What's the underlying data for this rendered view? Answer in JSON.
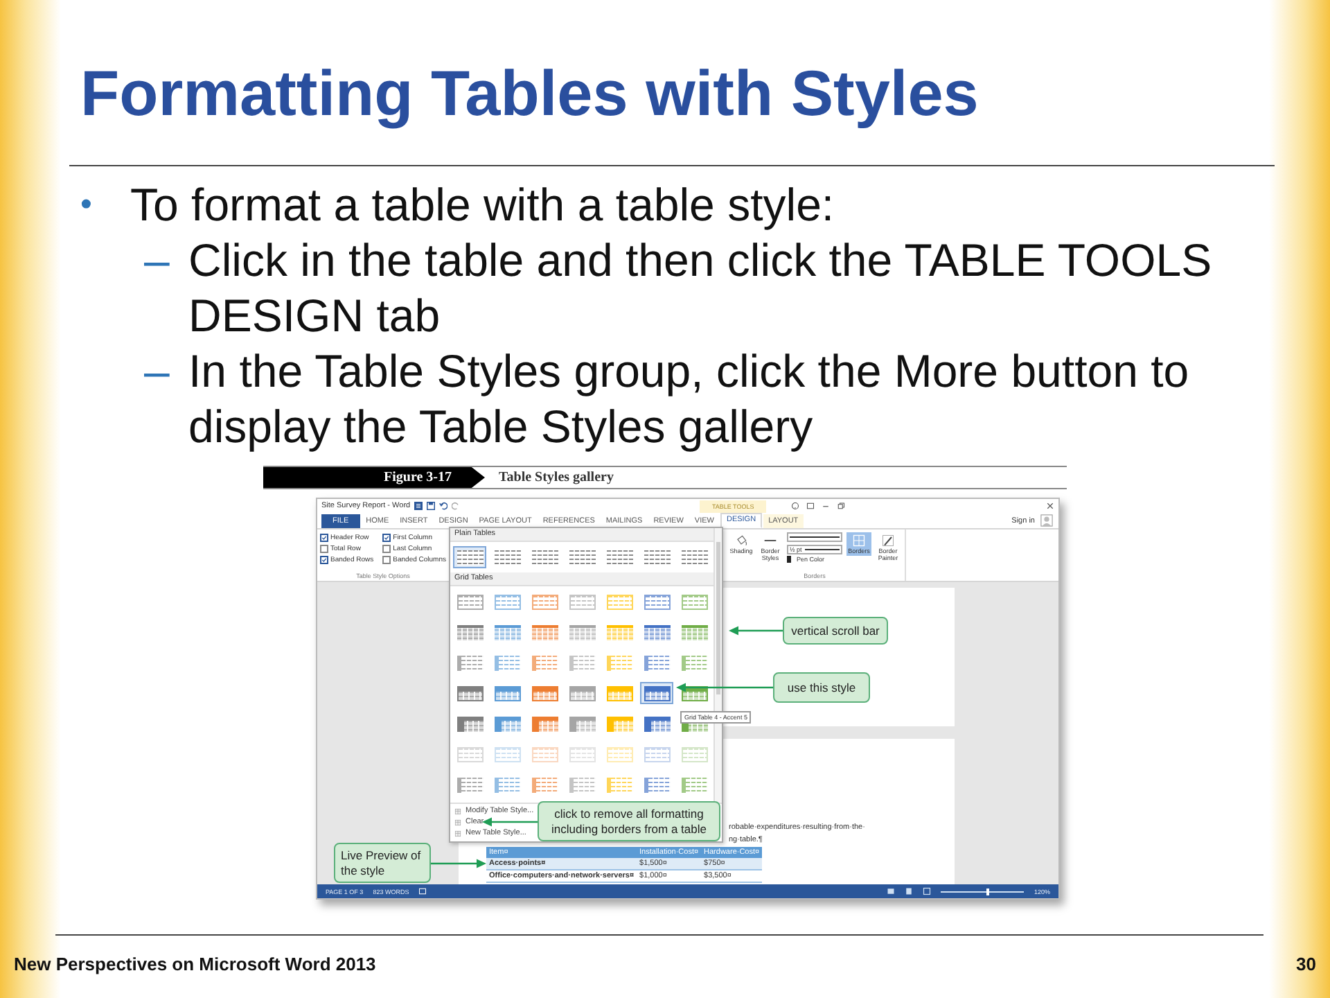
{
  "slide": {
    "title": "Formatting Tables with Styles",
    "bullets": [
      {
        "marker": "•",
        "text": "To format a table with a table style:",
        "children": [
          {
            "marker": "–",
            "text": "Click in the table and then click the TABLE TOOLS DESIGN tab"
          },
          {
            "marker": "–",
            "text": "In the Table Styles group, click the More button to display the Table Styles gallery"
          }
        ]
      }
    ]
  },
  "figure": {
    "number": "Figure 3-17",
    "caption": "Table Styles gallery",
    "window": {
      "title": "Site Survey Report - Word",
      "contextual_label": "TABLE TOOLS",
      "sign_in": "Sign in",
      "tabs": [
        {
          "label": "FILE",
          "kind": "file",
          "selected": false
        },
        {
          "label": "HOME",
          "kind": "normal",
          "selected": false
        },
        {
          "label": "INSERT",
          "kind": "normal",
          "selected": false
        },
        {
          "label": "DESIGN",
          "kind": "normal",
          "selected": false
        },
        {
          "label": "PAGE LAYOUT",
          "kind": "normal",
          "selected": false
        },
        {
          "label": "REFERENCES",
          "kind": "normal",
          "selected": false
        },
        {
          "label": "MAILINGS",
          "kind": "normal",
          "selected": false
        },
        {
          "label": "REVIEW",
          "kind": "normal",
          "selected": false
        },
        {
          "label": "VIEW",
          "kind": "normal",
          "selected": false
        },
        {
          "label": "DESIGN",
          "kind": "contextual",
          "selected": true
        },
        {
          "label": "LAYOUT",
          "kind": "contextual",
          "selected": false
        }
      ],
      "style_options": {
        "group_label": "Table Style Options",
        "items": [
          {
            "label": "Header Row",
            "checked": true
          },
          {
            "label": "First Column",
            "checked": true
          },
          {
            "label": "Total Row",
            "checked": false
          },
          {
            "label": "Last Column",
            "checked": false
          },
          {
            "label": "Banded Rows",
            "checked": true
          },
          {
            "label": "Banded Columns",
            "checked": false
          }
        ]
      },
      "borders_group": {
        "shading": "Shading",
        "border_styles": "Border Styles",
        "weight": "½ pt",
        "pen_color": "Pen Color",
        "borders": "Borders",
        "border_painter": "Border Painter",
        "group_label": "Borders"
      },
      "gallery": {
        "plain_label": "Plain Tables",
        "grid_label": "Grid Tables",
        "tooltip": "Grid Table 4 - Accent 5",
        "columns": [
          {
            "color": "#7f7f7f"
          },
          {
            "color": "#5b9bd5"
          },
          {
            "color": "#ed7d31"
          },
          {
            "color": "#a5a5a5"
          },
          {
            "color": "#ffc000"
          },
          {
            "color": "#4472c4"
          },
          {
            "color": "#70ad47"
          }
        ],
        "rows": [
          {
            "kind": "plain",
            "cells": [
              {
                "highlighted": true
              },
              {
                "highlighted": false
              },
              {
                "highlighted": false
              },
              {
                "highlighted": false
              },
              {
                "highlighted": false
              },
              {
                "highlighted": false
              },
              {
                "highlighted": false
              }
            ]
          },
          {
            "kind": "outline",
            "cells": [
              {
                "highlighted": false
              },
              {
                "highlighted": false
              },
              {
                "highlighted": false
              },
              {
                "highlighted": false
              },
              {
                "highlighted": false
              },
              {
                "highlighted": false
              },
              {
                "highlighted": false
              }
            ]
          },
          {
            "kind": "tinted",
            "cells": [
              {
                "highlighted": false
              },
              {
                "highlighted": false
              },
              {
                "highlighted": false
              },
              {
                "highlighted": false
              },
              {
                "highlighted": false
              },
              {
                "highlighted": false
              },
              {
                "highlighted": false
              }
            ]
          },
          {
            "kind": "list",
            "cells": [
              {
                "highlighted": false
              },
              {
                "highlighted": false
              },
              {
                "highlighted": false
              },
              {
                "highlighted": false
              },
              {
                "highlighted": false
              },
              {
                "highlighted": false
              },
              {
                "highlighted": false
              }
            ]
          },
          {
            "kind": "header",
            "cells": [
              {
                "highlighted": false
              },
              {
                "highlighted": false
              },
              {
                "highlighted": false
              },
              {
                "highlighted": false
              },
              {
                "highlighted": false
              },
              {
                "highlighted": true
              },
              {
                "highlighted": false
              }
            ]
          },
          {
            "kind": "dark",
            "cells": [
              {
                "highlighted": false
              },
              {
                "highlighted": false
              },
              {
                "highlighted": false
              },
              {
                "highlighted": false
              },
              {
                "highlighted": false
              },
              {
                "highlighted": false
              },
              {
                "highlighted": false
              }
            ]
          },
          {
            "kind": "soft",
            "cells": [
              {
                "highlighted": false
              },
              {
                "highlighted": false
              },
              {
                "highlighted": false
              },
              {
                "highlighted": false
              },
              {
                "highlighted": false
              },
              {
                "highlighted": false
              },
              {
                "highlighted": false
              }
            ]
          },
          {
            "kind": "list",
            "cells": [
              {
                "highlighted": false
              },
              {
                "highlighted": false
              },
              {
                "highlighted": false
              },
              {
                "highlighted": false
              },
              {
                "highlighted": false
              },
              {
                "highlighted": false
              },
              {
                "highlighted": false
              }
            ]
          }
        ],
        "menu": [
          {
            "label": "Modify Table Style..."
          },
          {
            "label": "Clear"
          },
          {
            "label": "New Table Style..."
          }
        ]
      },
      "document": {
        "text_lines": [
          "robable·expenditures·resulting·from·the·",
          "ng·table.¶"
        ],
        "table": {
          "columns": [
            "Item¤",
            "Installation·Cost¤",
            "Hardware·Cost¤"
          ],
          "rows": [
            [
              "Access·points¤",
              "$1,500¤",
              "$750¤"
            ],
            [
              "Office·computers·and·network·servers¤",
              "$1,000¤",
              "$3,500¤"
            ]
          ]
        }
      },
      "status_bar": {
        "page": "PAGE 1 OF 3",
        "words": "823 WORDS",
        "zoom": {
          "level": 0.55,
          "reading": "120%"
        }
      }
    },
    "callouts": [
      {
        "text": "vertical scroll bar"
      },
      {
        "text": "use this style"
      },
      {
        "text": "click to remove all formatting including borders from a table"
      },
      {
        "text": "Live Preview of the style"
      }
    ]
  },
  "footer": {
    "left": "New Perspectives on Microsoft Word 2013",
    "page": "30"
  }
}
